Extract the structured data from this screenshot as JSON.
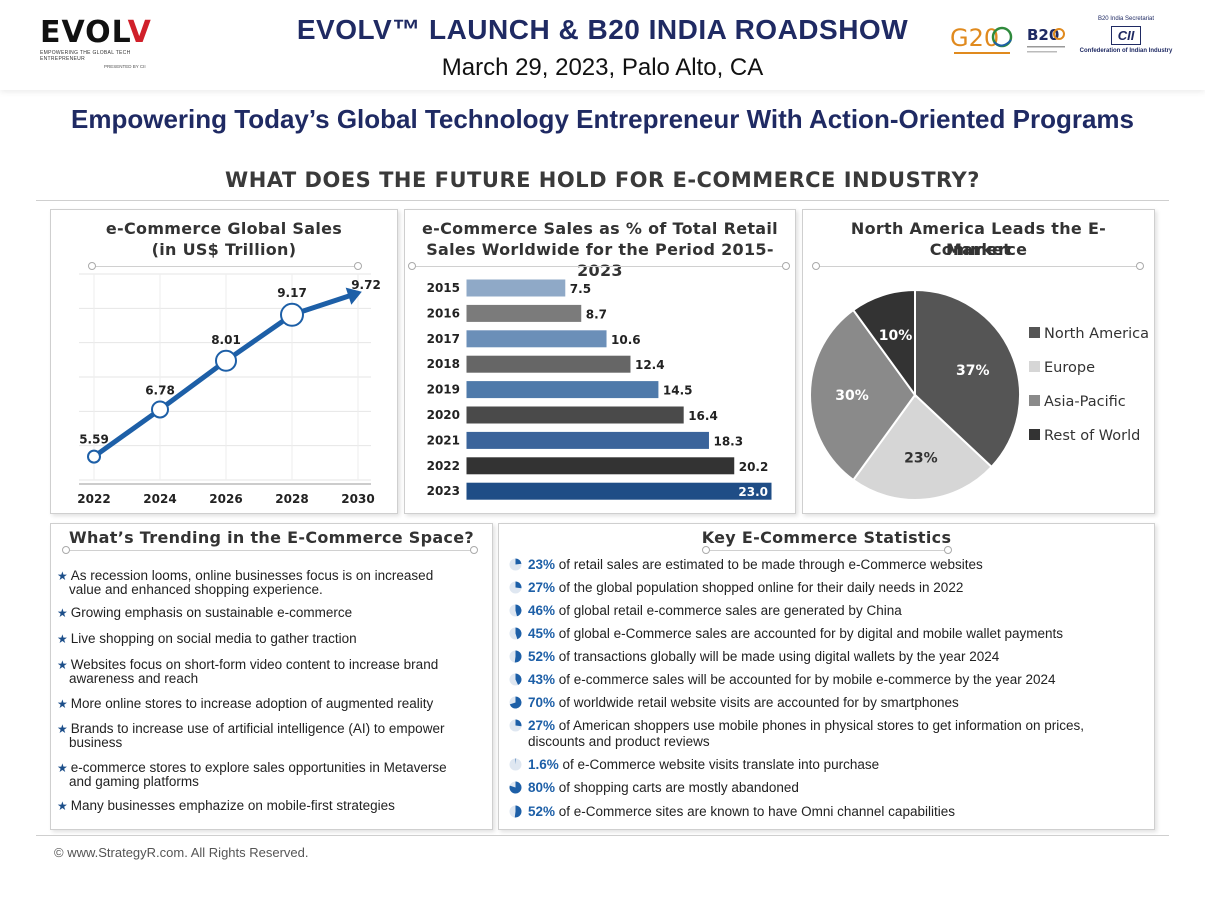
{
  "header": {
    "logo_word_main": "EVOL",
    "logo_word_v": "V",
    "logo_tagline": "EMPOWERING THE GLOBAL TECH ENTREPRENEUR",
    "logo_presented": "PRESENTED BY CII",
    "event_title": "EVOLV™ LAUNCH & B20 INDIA ROADSHOW",
    "event_subtitle": "March 29, 2023, Palo Alto, CA",
    "g20_text": "G20",
    "b20_text": "B20",
    "cii_top": "B20 India Secretariat",
    "cii_logo": "CII",
    "cii_name": "Confederation of Indian Industry"
  },
  "tagline": "Empowering Today’s Global Technology Entrepreneur With Action-Oriented Programs",
  "infographic": {
    "title": "WHAT DOES THE FUTURE HOLD FOR E-COMMERCE INDUSTRY?",
    "footer": "© www.StrategyR.com. All Rights Reserved."
  },
  "colors": {
    "navy": "#1f2a63",
    "accent_blue": "#1d5fa7",
    "brand_red": "#d0202a"
  },
  "chart_data": [
    {
      "type": "line",
      "title_lines": [
        "e-Commerce Global Sales",
        "(in US$ Trillion)"
      ],
      "x": [
        "2022",
        "2024",
        "2026",
        "2028",
        "2030"
      ],
      "values": [
        5.59,
        6.78,
        8.01,
        9.17,
        9.72
      ],
      "labels": [
        "5.59",
        "6.78",
        "8.01",
        "9.17",
        "9.72"
      ],
      "ylim": [
        5,
        10.2
      ],
      "grid": true,
      "color": "#1d5fa7"
    },
    {
      "type": "bar",
      "orientation": "horizontal",
      "title_lines": [
        "e-Commerce Sales as % of Total Retail",
        "Sales Worldwide for the Period 2015-2023"
      ],
      "categories": [
        "2015",
        "2016",
        "2017",
        "2018",
        "2019",
        "2020",
        "2021",
        "2022",
        "2023"
      ],
      "values": [
        7.5,
        8.7,
        10.6,
        12.4,
        14.5,
        16.4,
        18.3,
        20.2,
        23.0
      ],
      "labels": [
        "7.5",
        "8.7",
        "10.6",
        "12.4",
        "14.5",
        "16.4",
        "18.3",
        "20.2",
        "23.0"
      ],
      "colors": [
        "#8fa9c7",
        "#7b7b7b",
        "#6b8fb8",
        "#666666",
        "#4f7aaa",
        "#4a4a4a",
        "#3b649b",
        "#333333",
        "#1f4d86"
      ],
      "xlim": [
        0,
        23
      ]
    },
    {
      "type": "pie",
      "title_lines": [
        "North America Leads the E-Commerce",
        "Market"
      ],
      "slices": [
        {
          "name": "North America",
          "value": 37,
          "label": "37%",
          "color": "#555555"
        },
        {
          "name": "Europe",
          "value": 23,
          "label": "23%",
          "color": "#d6d6d6"
        },
        {
          "name": "Asia-Pacific",
          "value": 30,
          "label": "30%",
          "color": "#8a8a8a"
        },
        {
          "name": "Rest of World",
          "value": 10,
          "label": "10%",
          "color": "#333333"
        }
      ],
      "legend": "right"
    }
  ],
  "trends": {
    "title": "What’s Trending in the E-Commerce Space?",
    "items": [
      {
        "lines": [
          "As recession looms, online businesses focus is on increased",
          "value and enhanced shopping experience."
        ]
      },
      {
        "lines": [
          "Growing emphasis on sustainable e-commerce"
        ]
      },
      {
        "lines": [
          "Live shopping on social media to gather traction"
        ]
      },
      {
        "lines": [
          "Websites focus on short-form video content to increase brand",
          "awareness and reach"
        ]
      },
      {
        "lines": [
          "More online stores to increase adoption of augmented reality"
        ]
      },
      {
        "lines": [
          "Brands to increase use of artificial intelligence (AI) to empower",
          "business"
        ]
      },
      {
        "lines": [
          "e-commerce stores to explore sales opportunities in Metaverse",
          "and gaming platforms"
        ]
      },
      {
        "lines": [
          "Many businesses emphazize on mobile-first strategies"
        ]
      }
    ]
  },
  "stats": {
    "title": "Key E-Commerce Statistics",
    "items": [
      {
        "pct": "23%",
        "value": 23,
        "text": " of retail sales are estimated to be made through e-Commerce websites"
      },
      {
        "pct": "27%",
        "value": 27,
        "text": " of the global population shopped online for their daily needs in 2022"
      },
      {
        "pct": "46%",
        "value": 46,
        "text": " of global retail e-commerce sales are generated by China"
      },
      {
        "pct": "45%",
        "value": 45,
        "text": " of global e-Commerce sales are accounted for by digital and mobile wallet payments"
      },
      {
        "pct": "52%",
        "value": 52,
        "text": " of transactions globally will be made using digital wallets by the year 2024"
      },
      {
        "pct": "43%",
        "value": 43,
        "text": " of e-commerce sales will be accounted for by mobile e-commerce by the year 2024"
      },
      {
        "pct": "70%",
        "value": 70,
        "text": " of worldwide retail website visits are accounted for by smartphones"
      },
      {
        "pct": "27%",
        "value": 27,
        "text": " of American shoppers use mobile phones in physical stores to get information on prices,",
        "line2": "discounts and product reviews"
      },
      {
        "pct": "1.6%",
        "value": 1.6,
        "text": " of e-Commerce website visits translate into purchase"
      },
      {
        "pct": "80%",
        "value": 80,
        "text": " of shopping carts are mostly abandoned"
      },
      {
        "pct": "52%",
        "value": 52,
        "text": " of e-Commerce sites are known to have Omni channel capabilities"
      }
    ]
  }
}
